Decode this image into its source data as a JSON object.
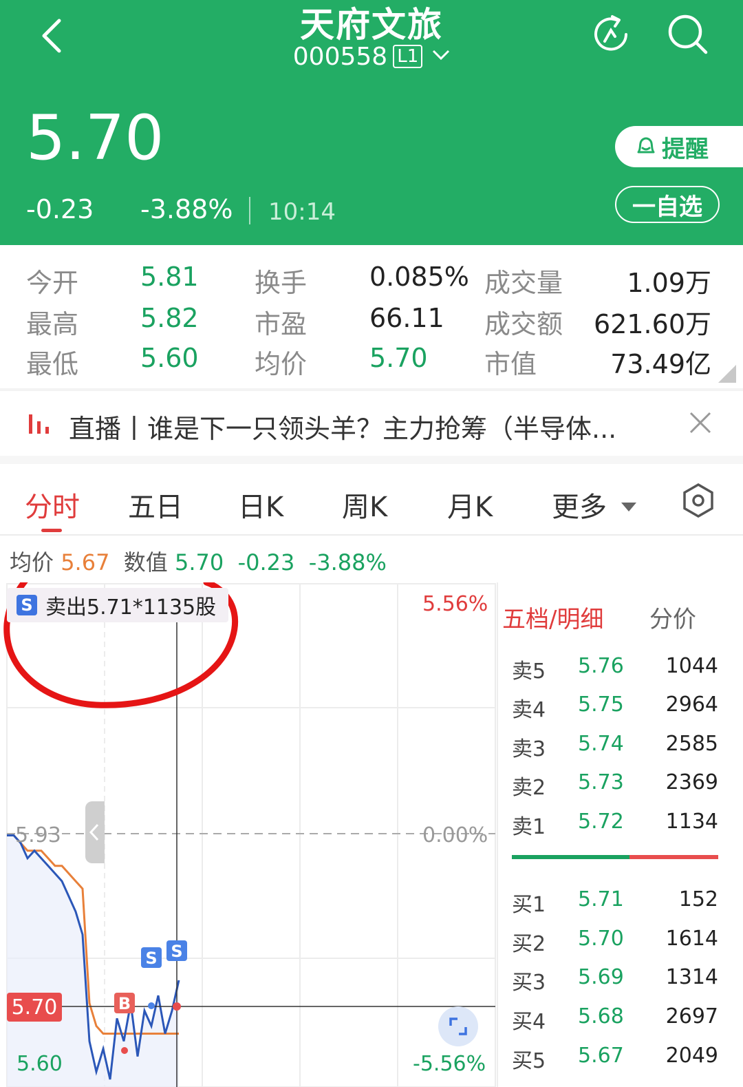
{
  "header": {
    "title": "天府文旅",
    "code": "000558",
    "level_badge": "L1",
    "price": "5.70",
    "change": "-0.23",
    "change_pct": "-3.88%",
    "time": "10:14",
    "remind_label": "提醒",
    "watchlist_label": "一自选"
  },
  "stats": [
    {
      "label": "今开",
      "value": "5.81"
    },
    {
      "label": "换手",
      "value": "0.085%"
    },
    {
      "label": "成交量",
      "value": "1.09万"
    },
    {
      "label": "最高",
      "value": "5.82"
    },
    {
      "label": "市盈",
      "value": "66.11"
    },
    {
      "label": "成交额",
      "value": "621.60万"
    },
    {
      "label": "最低",
      "value": "5.60"
    },
    {
      "label": "均价",
      "value": "5.70"
    },
    {
      "label": "市值",
      "value": "73.49亿"
    }
  ],
  "news": {
    "text": "直播丨谁是下一只领头羊？主力抢筹（半导体..."
  },
  "tabs": [
    {
      "label": "分时",
      "active": true
    },
    {
      "label": "五日"
    },
    {
      "label": "日K"
    },
    {
      "label": "周K"
    },
    {
      "label": "月K"
    },
    {
      "label": "更多"
    }
  ],
  "infobar": {
    "avg_label": "均价",
    "avg_value": "5.67",
    "val_label": "数值",
    "val_value": "5.70",
    "chg": "-0.23",
    "pct": "-3.88%"
  },
  "chart": {
    "sell_tag": "卖出5.71*1135股",
    "pct_top": "5.56%",
    "pct_mid": "0.00%",
    "pct_bot": "-5.56%",
    "label_prev_close": "5.93",
    "label_low": "5.60",
    "crosshair_price": "5.70",
    "marker_b": "B",
    "marker_s": "S"
  },
  "chart_data": {
    "type": "line",
    "series": [
      {
        "name": "价格",
        "values": [
          5.93,
          5.93,
          5.92,
          5.9,
          5.91,
          5.9,
          5.89,
          5.88,
          5.87,
          5.85,
          5.83,
          5.8,
          5.66,
          5.62,
          5.65,
          5.61,
          5.69,
          5.66,
          5.71,
          5.64,
          5.7,
          5.68,
          5.72,
          5.67,
          5.7,
          5.74
        ]
      },
      {
        "name": "均价",
        "values": [
          5.93,
          5.93,
          5.92,
          5.91,
          5.91,
          5.91,
          5.9,
          5.89,
          5.89,
          5.88,
          5.87,
          5.86,
          5.71,
          5.68,
          5.67,
          5.67,
          5.67,
          5.67,
          5.67,
          5.67,
          5.67,
          5.67,
          5.67,
          5.67,
          5.67,
          5.67
        ]
      }
    ],
    "ylim": [
      5.6,
      6.26
    ],
    "prev_close": 5.93
  },
  "orderbook": {
    "tab1": "五档/明细",
    "tab2": "分价",
    "sell": [
      {
        "k": "卖5",
        "p": "5.76",
        "q": "1044"
      },
      {
        "k": "卖4",
        "p": "5.75",
        "q": "2964"
      },
      {
        "k": "卖3",
        "p": "5.74",
        "q": "2585"
      },
      {
        "k": "卖2",
        "p": "5.73",
        "q": "2369"
      },
      {
        "k": "卖1",
        "p": "5.72",
        "q": "1134"
      }
    ],
    "buy": [
      {
        "k": "买1",
        "p": "5.71",
        "q": "152"
      },
      {
        "k": "买2",
        "p": "5.70",
        "q": "1614"
      },
      {
        "k": "买3",
        "p": "5.69",
        "q": "1314"
      },
      {
        "k": "买4",
        "p": "5.68",
        "q": "2697"
      },
      {
        "k": "买5",
        "p": "5.67",
        "q": "2049"
      }
    ],
    "buy_ratio": 0.57
  },
  "colors": {
    "brand": "#23ad65",
    "up": "#e03c3c",
    "down": "#1aa260",
    "price_line": "#2b57b8",
    "avg_line": "#e8803a"
  }
}
